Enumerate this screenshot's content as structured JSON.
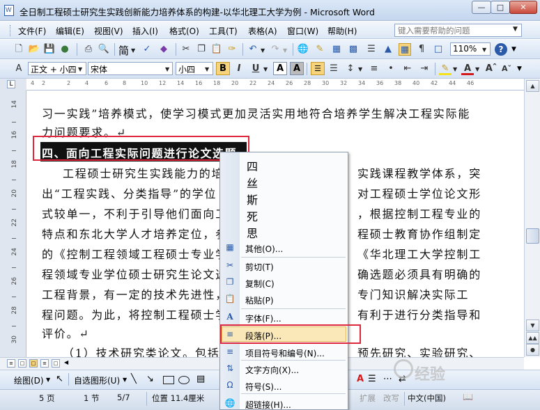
{
  "window": {
    "title": "全日制工程硕士研究生实践创新能力培养体系的构建-以华北理工大学为例 - Microsoft Word",
    "doc_icon": "W",
    "minimize": "0",
    "maximize": "1",
    "close": "r"
  },
  "menu": {
    "items": [
      "文件(F)",
      "编辑(E)",
      "视图(V)",
      "插入(I)",
      "格式(O)",
      "工具(T)",
      "表格(A)",
      "窗口(W)",
      "帮助(H)"
    ],
    "help_placeholder": "键入需要帮助的问题"
  },
  "toolbar1": {
    "traditional": "简",
    "zoom": "110%"
  },
  "toolbar2": {
    "style": "正文 + 小四",
    "font": "宋体",
    "size": "小四",
    "bold": "B",
    "italic": "I",
    "underline": "U",
    "char_border": "A",
    "char_shade": "A"
  },
  "ruler_h": {
    "marks": [
      "4",
      "2",
      "2",
      "4",
      "6",
      "8",
      "10",
      "12",
      "14",
      "16",
      "18",
      "20",
      "22",
      "24",
      "26",
      "28",
      "30",
      "32",
      "34",
      "36",
      "38",
      "40",
      "42",
      "44",
      "46"
    ]
  },
  "ruler_v": {
    "numbers": [
      "14",
      "16",
      "18",
      "20",
      "22",
      "24",
      "26",
      "28",
      "30"
    ]
  },
  "document": {
    "lines": [
      "习一实践”培养模式，使学习模式更加灵活实用地符合培养学生解决工程实际能",
      "力问题要求。↵",
      "工程硕士研究生实践能力的培",
      "实践课程教学体系，突",
      "出“工程实践、分类指导”的学位",
      "对工程硕士学位论文形",
      "式较单一，不利于引导他们面向工",
      "，根据控制工程专业的",
      "特点和东北大学人才培养定位，参",
      "程硕士教育协作组制定",
      "的《控制工程领域工程硕士专业学",
      "《华北理工大学控制工",
      "程领域专业学位硕士研究生论文选",
      "确选题必须具有明确的",
      "工程背景，有一定的技术先进性，",
      "专门知识解决实际工",
      "程问题。为此，将控制工程硕士学",
      "有利于进行分类指导和",
      "评价。↵",
      "（1）技术研究类论文。包括应",
      "预先研究、实验研究、"
    ],
    "heading": "四、面向工程实际问题进行论文选题"
  },
  "context_menu": {
    "chars": [
      "四",
      "丝",
      "斯",
      "死",
      "思"
    ],
    "items": [
      {
        "label": "其他(O)...",
        "icon": "other-icon"
      },
      {
        "label": "剪切(T)",
        "icon": "cut-icon"
      },
      {
        "label": "复制(C)",
        "icon": "copy-icon"
      },
      {
        "label": "粘贴(P)",
        "icon": "paste-icon"
      },
      {
        "label": "字体(F)...",
        "icon": "font-icon"
      },
      {
        "label": "段落(P)...",
        "icon": "paragraph-icon"
      },
      {
        "label": "项目符号和编号(N)...",
        "icon": "bullets-icon"
      },
      {
        "label": "文字方向(X)...",
        "icon": "text-direction-icon"
      },
      {
        "label": "符号(S)...",
        "icon": "symbol-icon"
      },
      {
        "label": "超链接(H)...",
        "icon": "hyperlink-icon"
      }
    ],
    "highlighted": "段落(P)..."
  },
  "drawbar": {
    "draw": "绘图(D)",
    "autoshapes": "自选图形(U)"
  },
  "status": {
    "page": "5 页",
    "section": "1 节",
    "page_of": "5/7",
    "position": "位置 11.4厘米",
    "ext": "扩展",
    "ovr": "改写",
    "language": "中文(中国)"
  },
  "watermark": "经验",
  "colors": {
    "highlight_red": "#e0263a",
    "menu_highlight": "#fbe8b8",
    "selection": "#111111"
  }
}
